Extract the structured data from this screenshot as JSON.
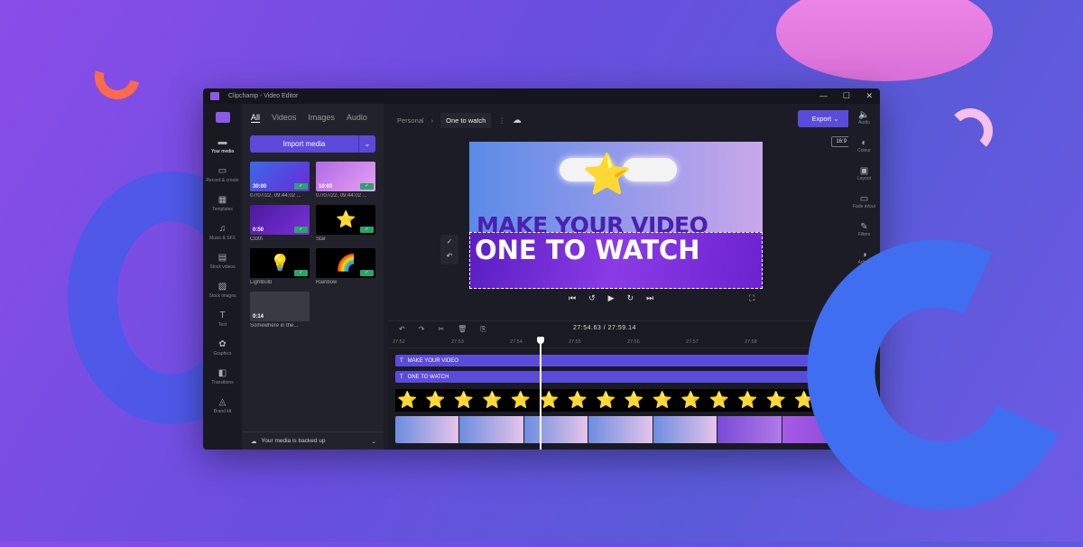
{
  "window": {
    "title": "Clipchamp - Video Editor",
    "minimize": "—",
    "maximize": "☐",
    "close": "✕"
  },
  "left_rail": [
    {
      "label": "Your media",
      "icon": "▬"
    },
    {
      "label": "Record & create",
      "icon": "▭"
    },
    {
      "label": "Templates",
      "icon": "▦"
    },
    {
      "label": "Music & SFX",
      "icon": "♫"
    },
    {
      "label": "Stock videos",
      "icon": "▤"
    },
    {
      "label": "Stock images",
      "icon": "▨"
    },
    {
      "label": "Text",
      "icon": "T"
    },
    {
      "label": "Graphics",
      "icon": "✿"
    },
    {
      "label": "Transitions",
      "icon": "◧"
    },
    {
      "label": "Brand kit",
      "icon": "◬"
    }
  ],
  "media": {
    "tabs": [
      "All",
      "Videos",
      "Images",
      "Audio"
    ],
    "import_label": "Import media",
    "dropdown": "⌄",
    "items": [
      {
        "duration": "30:00",
        "caption": "07/07/22, 09:44:02 ..."
      },
      {
        "duration": "10:00",
        "caption": "07/07/22, 09:44:02 ..."
      },
      {
        "duration": "0:50",
        "caption": "Cloth"
      },
      {
        "duration": "",
        "caption": "Star"
      },
      {
        "duration": "",
        "caption": "Lightbulb"
      },
      {
        "duration": "",
        "caption": "Rainbow"
      },
      {
        "duration": "0:14",
        "caption": "Somewhere in the..."
      }
    ],
    "check": "✓",
    "backup": "Your media is backed up",
    "backup_icon": "☁",
    "chevron": "⌄"
  },
  "breadcrumb": {
    "parent": "Personal",
    "sep": "›",
    "current": "One to watch",
    "more": "⋮",
    "cloud": "☁"
  },
  "export_label": "Export ⌄",
  "aspect_ratio": "16:9",
  "preview": {
    "line1": "MAKE YOUR VIDEO",
    "line2": "ONE TO WATCH",
    "star": "⭐"
  },
  "side_tools": [
    "✓",
    "↶"
  ],
  "playback": [
    "⏮",
    "↺",
    "▶",
    "↻",
    "⏭"
  ],
  "fullscreen": "⛶",
  "timeline": {
    "tools": [
      "↶",
      "↷",
      "✂",
      "🗑",
      "⎘"
    ],
    "current_time": "27:54.63",
    "total_time": "27:59.14",
    "sep": "/",
    "zoom_in": "+",
    "zoom_out": "−",
    "ticks": [
      "27:52",
      "27:53",
      "27:54",
      "27:55",
      "27:56",
      "27:57",
      "27:58"
    ],
    "text_tracks": [
      "MAKE YOUR VIDEO",
      "ONE TO WATCH"
    ],
    "text_icon": "T",
    "sticker": "⭐",
    "sticker_count": 15
  },
  "right_rail": [
    {
      "label": "Audio",
      "icon": "🔈"
    },
    {
      "label": "Colour",
      "icon": "◐"
    },
    {
      "label": "Layout",
      "icon": "▣"
    },
    {
      "label": "Fade in/out",
      "icon": "▭"
    },
    {
      "label": "Filters",
      "icon": "✎"
    },
    {
      "label": "Adjust",
      "icon": "◑"
    }
  ],
  "colors": {
    "accent": "#5b4bdb",
    "bg": "#1c1c26",
    "success": "#2ba36d"
  }
}
